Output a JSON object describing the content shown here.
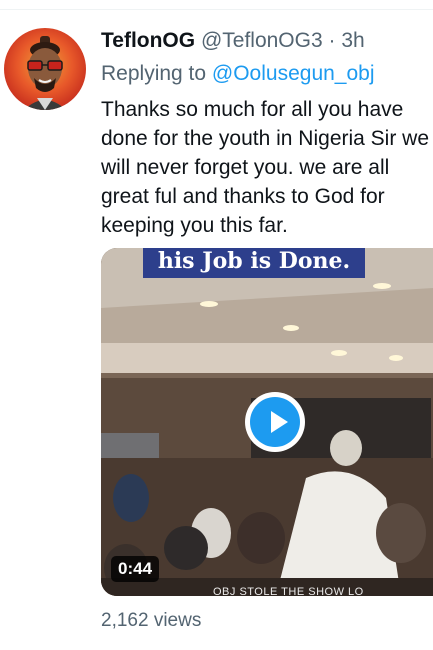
{
  "tweet": {
    "author": {
      "display_name": "TeflonOG",
      "handle": "@TeflonOG3",
      "separator": "·",
      "time": "3h"
    },
    "reply": {
      "prefix": "Replying to",
      "mention": "@Oolusegun_obj"
    },
    "text_lines": [
      "Thanks so much for all you have",
      "done for the youth in Nigeria Sir we",
      "will never forget you. we are all",
      "great ful and thanks to God for",
      "keeping you this far."
    ],
    "media": {
      "caption": "his Job is Done.",
      "duration": "0:44",
      "watermark": "OBJ STOLE THE SHOW LO"
    },
    "views": "2,162 views"
  },
  "colors": {
    "accent": "#1d9bf0",
    "muted": "#536471",
    "text": "#0f1419",
    "caption_bg": "#2d3f8c"
  },
  "icons": {
    "play": "play-icon",
    "avatar": "avatar-image"
  }
}
